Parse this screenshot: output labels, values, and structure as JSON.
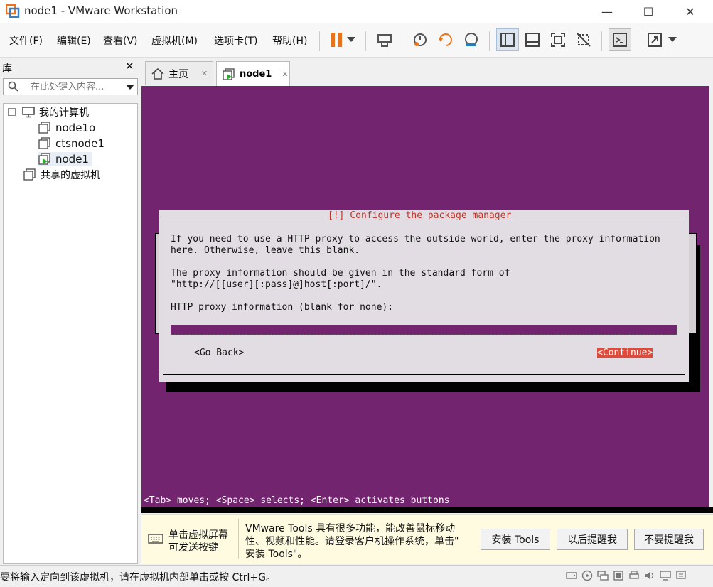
{
  "window": {
    "title": "node1 - VMware Workstation",
    "minimize": "—",
    "maximize": "☐",
    "close": "✕"
  },
  "menu": [
    {
      "label": "文件(F)"
    },
    {
      "label": "编辑(E)"
    },
    {
      "label": "查看(V)"
    },
    {
      "label": "虚拟机(M)"
    },
    {
      "label": "选项卡(T)"
    },
    {
      "label": "帮助(H)"
    }
  ],
  "library": {
    "title": "库",
    "close": "✕",
    "search_placeholder": "在此处键入内容...",
    "tree": {
      "root": "我的计算机",
      "children": [
        "node1o",
        "ctsnode1",
        "node1"
      ],
      "shared": "共享的虚拟机"
    }
  },
  "tabs": [
    {
      "label": "主页",
      "close": "✕"
    },
    {
      "label": "node1",
      "close": "✕"
    }
  ],
  "vm": {
    "dialog_title": "[!] Configure the package manager",
    "line1": "If you need to use a HTTP proxy to access the outside world, enter the proxy information",
    "line2": "here. Otherwise, leave this blank.",
    "line3": "The proxy information should be given in the standard form of",
    "line4": "\"http://[[user][:pass]@]host[:port]/\".",
    "line5": "HTTP proxy information (blank for none):",
    "go_back": "<Go Back>",
    "continue": "<Continue>",
    "hint": "<Tab> moves; <Space> selects; <Enter> activates buttons"
  },
  "infobar": {
    "left_line1": "单击虚拟屏幕",
    "left_line2": "可发送按键",
    "message_line1": "VMware Tools 具有很多功能，能改善鼠标移动",
    "message_line2": "性、视频和性能。请登录客户机操作系统，单击\"",
    "message_line3": "安装 Tools\"。",
    "install_button": "安装 Tools",
    "later_button": "以后提醒我",
    "never_button": "不要提醒我"
  },
  "status": {
    "text": "要将输入定向到该虚拟机，请在虚拟机内部单击或按 Ctrl+G。"
  },
  "colors": {
    "vm_bg": "#72246f",
    "accent_orange": "#e8731e",
    "continue_red": "#e04a3a"
  }
}
